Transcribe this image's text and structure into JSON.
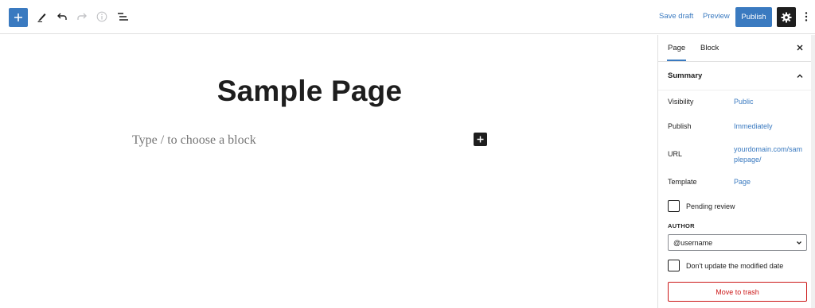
{
  "toolbar": {
    "save_draft": "Save draft",
    "preview": "Preview",
    "publish": "Publish",
    "icons": [
      "plus-icon",
      "pencil-icon",
      "undo-icon",
      "redo-icon",
      "info-icon",
      "list-view-icon",
      "gear-icon",
      "more-vertical-icon"
    ]
  },
  "editor": {
    "title": "Sample Page",
    "placeholder": "Type / to choose a block"
  },
  "sidebar": {
    "tabs": [
      {
        "label": "Page",
        "active": true
      },
      {
        "label": "Block",
        "active": false
      }
    ],
    "summary": {
      "title": "Summary",
      "rows": [
        {
          "label": "Visibility",
          "value": "Public"
        },
        {
          "label": "Publish",
          "value": "Immediately"
        },
        {
          "label": "URL",
          "value": "yourdomain.com/samplepage/"
        },
        {
          "label": "Template",
          "value": "Page"
        }
      ],
      "pending_review": {
        "label": "Pending review",
        "checked": false
      },
      "author": {
        "label": "AUTHOR",
        "value": "@username"
      },
      "dont_update": {
        "label": "Don't update the modified date",
        "checked": false
      },
      "trash": "Move to trash"
    }
  },
  "colors": {
    "accent": "#3a7ac0",
    "dark": "#1e1e1e",
    "danger": "#cc1818",
    "border": "#e0e0e0"
  }
}
